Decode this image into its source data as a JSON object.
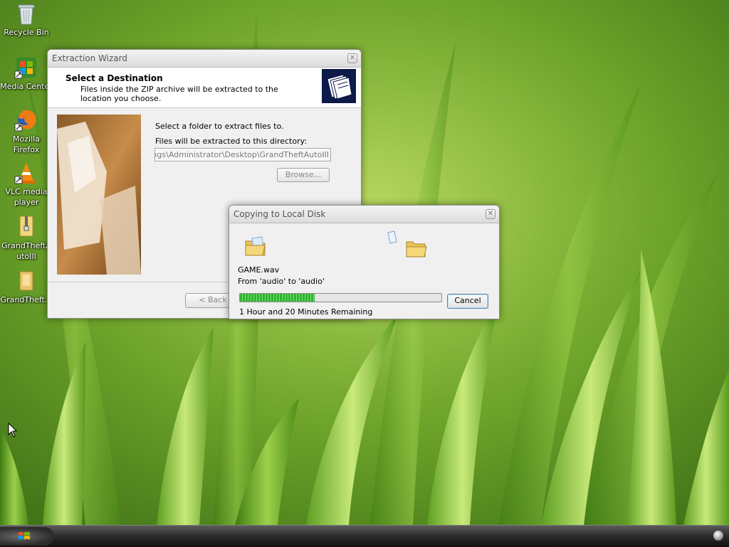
{
  "desktop": {
    "icons": [
      {
        "label": "Recycle Bin",
        "icon": "recycle-bin-icon"
      },
      {
        "label": "Media Center",
        "icon": "media-center-icon"
      },
      {
        "label": "Mozilla Firefox",
        "icon": "firefox-icon"
      },
      {
        "label": "VLC media player",
        "icon": "vlc-icon"
      },
      {
        "label": "GrandTheftAutoIII",
        "icon": "zip-folder-icon"
      },
      {
        "label": "GrandTheft...",
        "icon": "folder-icon"
      }
    ]
  },
  "wizard": {
    "title": "Extraction Wizard",
    "close_label": "✕",
    "header_title": "Select a Destination",
    "header_subtitle": "Files inside the ZIP archive will be extracted to the location you choose.",
    "instruction": "Select a folder to extract files to.",
    "dir_label": "Files will be extracted to this directory:",
    "dir_value": "Settings\\Administrator\\Desktop\\GrandTheftAutoIII",
    "browse_label": "Browse...",
    "back_label": "< Back"
  },
  "copy_dialog": {
    "title": "Copying to Local Disk",
    "close_label": "✕",
    "file_name": "GAME.wav",
    "route": "From 'audio' to 'audio'",
    "progress": 0.37,
    "time_remaining": "1 Hour and 20 Minutes Remaining",
    "cancel_label": "Cancel"
  },
  "colors": {
    "progress_green": "#2fb52f",
    "wallpaper_green": "#4d8a1a"
  }
}
